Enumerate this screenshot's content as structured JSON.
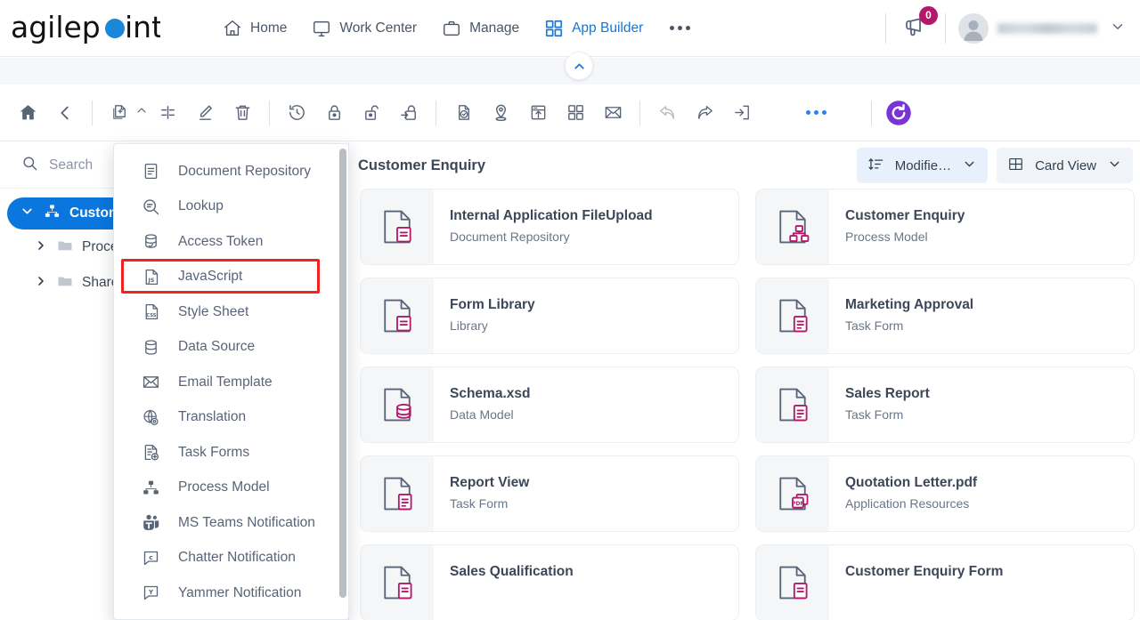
{
  "brand": {
    "name": "agilepoint",
    "accent_blue": "#1a87d8",
    "accent_purple": "#7b34d4",
    "accent_pink": "#b5176b"
  },
  "header": {
    "nav": [
      {
        "label": "Home",
        "icon": "home-icon",
        "active": false
      },
      {
        "label": "Work Center",
        "icon": "monitor-icon",
        "active": false
      },
      {
        "label": "Manage",
        "icon": "briefcase-icon",
        "active": false
      },
      {
        "label": "App Builder",
        "icon": "grid-icon",
        "active": true
      }
    ],
    "more_label": "more-options",
    "notification_count": "0",
    "user_name": ""
  },
  "collapse_button": {
    "icon": "chevron-up-icon"
  },
  "toolbar": {
    "items": [
      {
        "name": "home-icon"
      },
      {
        "name": "back-icon"
      },
      {
        "name": "add-item-icon"
      },
      {
        "name": "add-item-caret-icon"
      },
      {
        "name": "rename-icon"
      },
      {
        "name": "edit-icon"
      },
      {
        "name": "delete-icon"
      },
      {
        "name": "history-icon"
      },
      {
        "name": "lock-icon"
      },
      {
        "name": "unlock-icon"
      },
      {
        "name": "checkout-icon"
      },
      {
        "name": "validate-icon"
      },
      {
        "name": "location-icon"
      },
      {
        "name": "publish-icon"
      },
      {
        "name": "apps-icon"
      },
      {
        "name": "email-icon"
      },
      {
        "name": "undo-icon"
      },
      {
        "name": "share-icon"
      },
      {
        "name": "import-icon"
      },
      {
        "name": "more-icon"
      },
      {
        "name": "refresh-icon"
      }
    ]
  },
  "sidebar": {
    "search": {
      "placeholder": "Search",
      "icon": "search-icon"
    },
    "tree": [
      {
        "label": "Custom",
        "icon": "app-icon",
        "selected": true,
        "expanded": true
      },
      {
        "label": "Proce",
        "icon": "folder-icon",
        "selected": false
      },
      {
        "label": "Share",
        "icon": "folder-icon",
        "selected": false
      }
    ]
  },
  "main": {
    "title": "Customer Enquiry",
    "sort_dropdown": {
      "label": "Modifie…",
      "icon": "sort-icon"
    },
    "view_dropdown": {
      "label": "Card View",
      "icon": "card-view-icon"
    },
    "cards": [
      {
        "title": "Internal Application FileUpload",
        "subtitle": "Document Repository",
        "icon": "document-repository-icon"
      },
      {
        "title": "Customer Enquiry",
        "subtitle": "Process Model",
        "icon": "process-model-icon"
      },
      {
        "title": "Form Library",
        "subtitle": "Library",
        "icon": "library-icon"
      },
      {
        "title": "Marketing Approval",
        "subtitle": "Task Form",
        "icon": "task-form-icon"
      },
      {
        "title": "Schema.xsd",
        "subtitle": "Data Model",
        "icon": "data-model-icon"
      },
      {
        "title": "Sales Report",
        "subtitle": "Task Form",
        "icon": "task-form-icon"
      },
      {
        "title": "Report View",
        "subtitle": "Task Form",
        "icon": "task-form-icon"
      },
      {
        "title": "Quotation Letter.pdf",
        "subtitle": "Application Resources",
        "icon": "pdf-icon"
      },
      {
        "title": "Sales Qualification",
        "subtitle": "",
        "icon": "task-form-icon"
      },
      {
        "title": "Customer Enquiry Form",
        "subtitle": "",
        "icon": "task-form-icon"
      }
    ]
  },
  "menu": {
    "items": [
      {
        "label": "Document Repository",
        "icon": "document-repository-icon",
        "highlighted": false
      },
      {
        "label": "Lookup",
        "icon": "lookup-icon",
        "highlighted": false
      },
      {
        "label": "Access Token",
        "icon": "access-token-icon",
        "highlighted": false
      },
      {
        "label": "JavaScript",
        "icon": "javascript-icon",
        "highlighted": true
      },
      {
        "label": "Style Sheet",
        "icon": "css-icon",
        "highlighted": false
      },
      {
        "label": "Data Source",
        "icon": "database-icon",
        "highlighted": false
      },
      {
        "label": "Email Template",
        "icon": "email-icon",
        "highlighted": false
      },
      {
        "label": "Translation",
        "icon": "translation-icon",
        "highlighted": false
      },
      {
        "label": "Task Forms",
        "icon": "task-forms-icon",
        "highlighted": false
      },
      {
        "label": "Process Model",
        "icon": "process-model-icon",
        "highlighted": false
      },
      {
        "label": "MS Teams Notification",
        "icon": "ms-teams-icon",
        "highlighted": false
      },
      {
        "label": "Chatter Notification",
        "icon": "chatter-icon",
        "highlighted": false
      },
      {
        "label": "Yammer Notification",
        "icon": "yammer-icon",
        "highlighted": false
      }
    ],
    "highlight_color": "#f02222"
  }
}
